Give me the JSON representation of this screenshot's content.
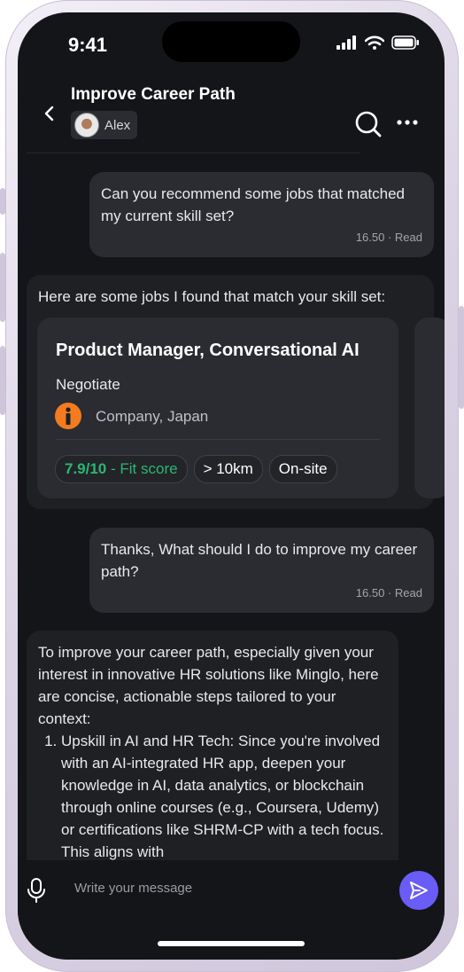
{
  "status": {
    "time": "9:41"
  },
  "header": {
    "title": "Improve Career Path",
    "user": "Alex"
  },
  "messages": [
    {
      "type": "outgoing",
      "text": "Can you recommend some jobs that matched my current skill set?",
      "meta": "16.50 · Read"
    },
    {
      "type": "incoming",
      "text": "Here are some jobs I found that match your skill set:"
    },
    {
      "type": "outgoing",
      "text": "Thanks, What should I do to improve my career path?",
      "meta": "16.50 · Read"
    },
    {
      "type": "incoming",
      "intro": "To improve your career path, especially given your interest in innovative HR solutions like Minglo, here are concise, actionable steps tailored to your context:",
      "list": [
        "Upskill in AI and HR Tech: Since you're involved with an AI-integrated HR app, deepen your knowledge in AI, data analytics, or blockchain through online courses (e.g., Coursera, Udemy) or certifications like SHRM-CP with a tech focus. This aligns with"
      ]
    }
  ],
  "job": {
    "title": "Product Manager, Conversational AI",
    "salary": "Negotiate",
    "company": "Company, Japan",
    "fit_score": "7.9/10",
    "fit_label": "- Fit score",
    "distance": "> 10km",
    "work_mode": "On-site"
  },
  "composer": {
    "placeholder": "Write your message"
  },
  "colors": {
    "background": "#141518",
    "bubble": "#2a2c31",
    "accent": "#6a5cf6",
    "fit_green": "#2bb673",
    "logo_orange": "#f47b20"
  },
  "icons": {
    "back": "chevron-left-icon",
    "search": "search-icon",
    "more": "more-horizontal-icon",
    "mic": "microphone-icon",
    "send": "send-icon",
    "company": "info-icon"
  }
}
